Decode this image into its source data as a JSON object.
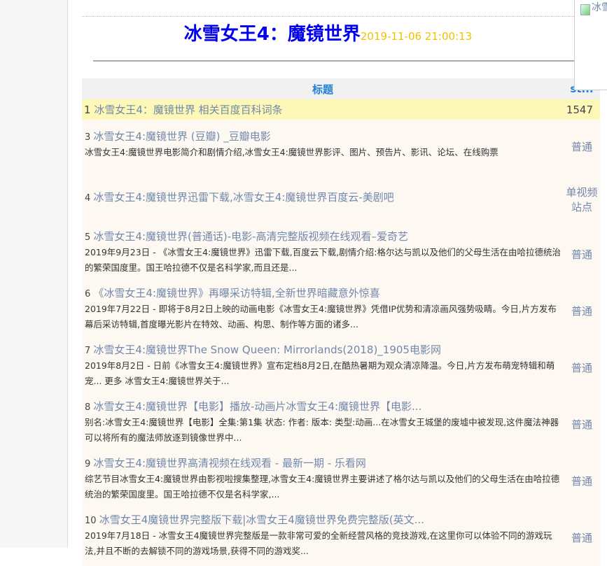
{
  "header": {
    "title": "冰雪女王4：魔镜世界",
    "date": "2019-11-06 21:00:13"
  },
  "table": {
    "col_title": "标题",
    "col_second": "st..."
  },
  "top_row": {
    "num": "1",
    "title": "冰雪女王4：魔镜世界 相关百度百科词条",
    "count": "1547"
  },
  "rows": [
    {
      "num": "3",
      "title": "冰雪女王4:魔镜世界 (豆瓣) _豆瓣电影",
      "desc": "冰雪女王4:魔镜世界电影简介和剧情介绍,冰雪女王4:魔镜世界影评、图片、预告片、影讯、论坛、在线购票",
      "type": "普通"
    },
    {
      "num": "4",
      "title": "冰雪女王4:魔镜世界迅雷下载,冰雪女王4:魔镜世界百度云-美剧吧",
      "desc": "",
      "type": "单视频站点"
    },
    {
      "num": "5",
      "title": "冰雪女王4:魔镜世界(普通话)-电影-高清完整版视频在线观看–爱奇艺",
      "desc": "2019年9月23日 - 《冰雪女王4:魔镜世界》迅雷下载,百度云下载,剧情介绍:格尔达与凯以及他们的父母生活在由哈拉德统治的繁荣国度里。国王哈拉德不仅是名科学家,而且还是...",
      "type": "普通"
    },
    {
      "num": "6",
      "title": "《冰雪女王4:魔镜世界》再曝采访特辑,全新世界暗藏意外惊喜",
      "desc": "2019年7月22日 - 即将于8月2日上映的动画电影《冰雪女王4:魔镜世界》凭借IP优势和清凉画风强势吸睛。今日,片方发布幕后采访特辑,首度曝光影片在特效、动画、构思、制作等方面的诸多...",
      "type": "普通"
    },
    {
      "num": "7",
      "title": "冰雪女王4:魔镜世界The Snow Queen: Mirrorlands(2018)_1905电影网",
      "desc": "2019年8月2日 - 日前《冰雪女王4:魔镜世界》宣布定档8月2日,在酷热暑期为观众清凉降温。今日,片方发布萌宠特辑和萌宠... 更多 冰雪女王4:魔镜世界关于...",
      "type": "普通"
    },
    {
      "num": "8",
      "title": "冰雪女王4:魔镜世界【电影】播放-动画片冰雪女王4:魔镜世界【电影...",
      "desc": "别名:冰雪女王4:魔镜世界【电影】全集:第1集 状态: 作者: 版本: 类型:动画...在冰雪女王城堡的废墟中被发现,这件魔法神器可以将所有的魔法师放逐到镜像世界中...",
      "type": "普通"
    },
    {
      "num": "9",
      "title": "冰雪女王4:魔镜世界高清视频在线观看 - 最新一期 - 乐看网",
      "desc": "综艺节目冰雪女王4:魔镜世界由影视啦搜集整理,冰雪女王4:魔镜世界主要讲述了格尔达与凯以及他们的父母生活在由哈拉德统治的繁荣国度里。国王哈拉德不仅是名科学家,...",
      "type": "普通"
    },
    {
      "num": "10",
      "title": "冰雪女王4魔镜世界完整版下载|冰雪女王4魔镜世界免费完整版(英文...",
      "desc": "2019年7月18日 - 冰雪女王4魔镜世界完整版是一款非常可爱的全新经营风格的竞技游戏,在这里你可以体验不同的游戏玩法,并且不断的去解锁不同的游戏场景,获得不同的游戏奖...",
      "type": "普通"
    }
  ],
  "broken_image": {
    "alt": "冰雪"
  }
}
